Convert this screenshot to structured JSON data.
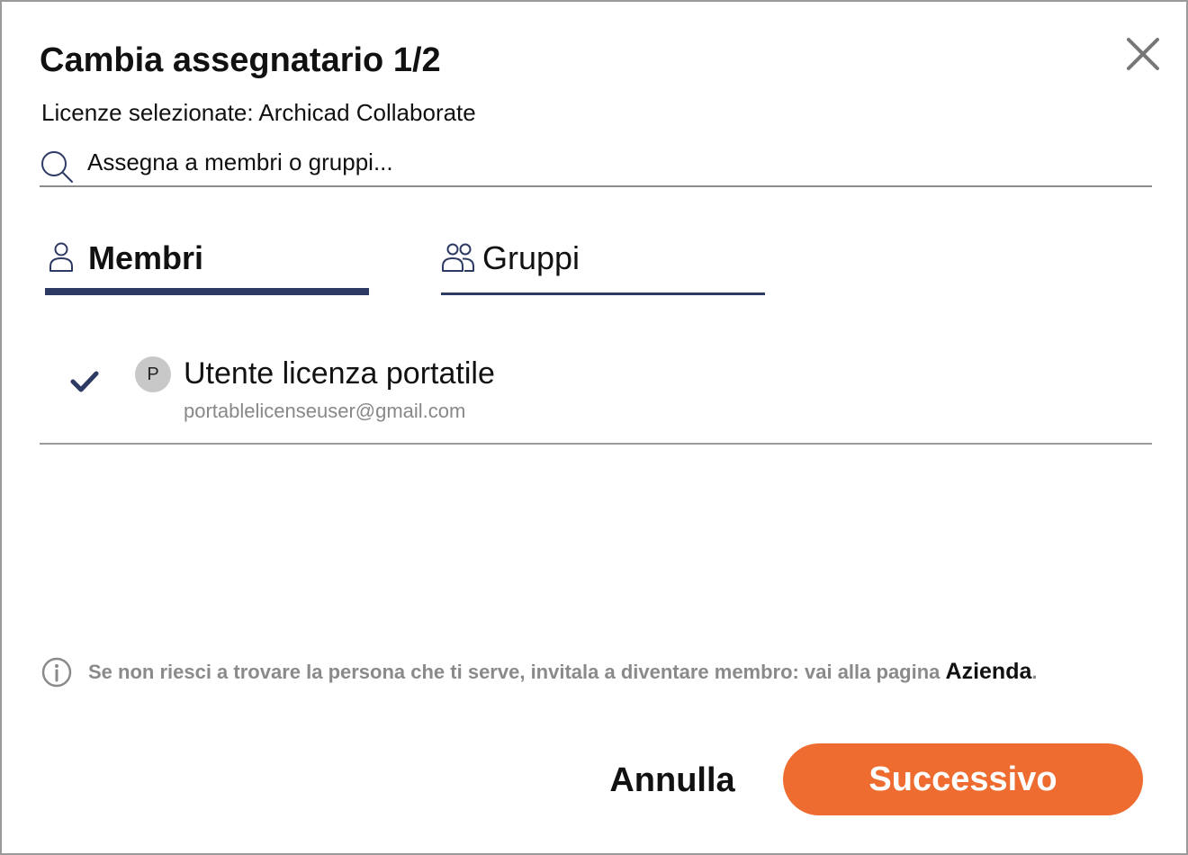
{
  "dialog": {
    "title": "Cambia assegnatario 1/2",
    "subtitle": "Licenze selezionate: Archicad Collaborate",
    "close_icon": "close-icon"
  },
  "search": {
    "placeholder": "Assegna a membri o gruppi...",
    "icon": "search-icon"
  },
  "tabs": [
    {
      "label": "Membri",
      "icon": "person-icon",
      "active": true
    },
    {
      "label": "Gruppi",
      "icon": "group-icon",
      "active": false
    }
  ],
  "members": [
    {
      "initial": "P",
      "name": "Utente licenza portatile",
      "email": "portablelicenseuser@gmail.com",
      "selected": true
    }
  ],
  "info": {
    "text": "Se non riesci a trovare la persona che ti serve, invitala a diventare membro: vai alla pagina ",
    "link": "Azienda",
    "suffix": ".",
    "icon": "info-icon"
  },
  "buttons": {
    "cancel": "Annulla",
    "next": "Successivo"
  },
  "colors": {
    "accent": "#ee6c2f",
    "tab_underline": "#2d3a64",
    "check": "#2d3a64",
    "muted_text": "#8a8a8a"
  }
}
